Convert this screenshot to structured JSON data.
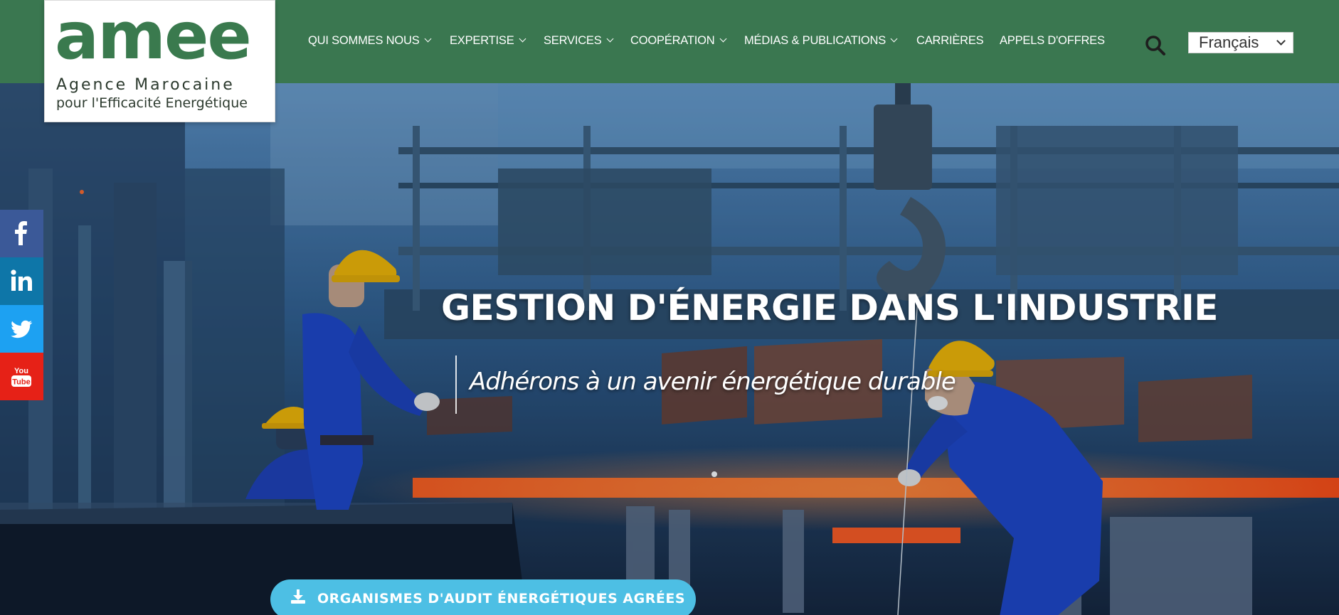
{
  "logo": {
    "wordmark": "amee",
    "line1": "Agence Marocaine",
    "line2": "pour l'Efficacité Energétique"
  },
  "nav": {
    "items": [
      {
        "label": "QUI SOMMES NOUS",
        "has_dropdown": true
      },
      {
        "label": "EXPERTISE",
        "has_dropdown": true
      },
      {
        "label": "SERVICES",
        "has_dropdown": true
      },
      {
        "label": "COOPÉRATION",
        "has_dropdown": true
      },
      {
        "label": "MÉDIAS & PUBLICATIONS",
        "has_dropdown": true
      },
      {
        "label": "CARRIÈRES",
        "has_dropdown": false
      },
      {
        "label": "APPELS D'OFFRES",
        "has_dropdown": false
      }
    ],
    "search_icon": "search-icon",
    "language": "Français"
  },
  "hero": {
    "title": "GESTION D'ÉNERGIE DANS L'INDUSTRIE",
    "subtitle": "Adhérons à un avenir énergétique durable",
    "cta_label": "ORGANISMES D'AUDIT ÉNERGÉTIQUES AGRÉES",
    "cta_icon": "download-icon"
  },
  "social": [
    {
      "name": "facebook-icon",
      "color": "#3b5998"
    },
    {
      "name": "linkedin-icon",
      "color": "#0e76a8"
    },
    {
      "name": "twitter-icon",
      "color": "#1da1f2"
    },
    {
      "name": "youtube-icon",
      "color": "#e62117"
    }
  ],
  "colors": {
    "header_green": "#3a7750",
    "logo_green": "#3a7a4e",
    "cta_blue": "#4dbfe4"
  }
}
